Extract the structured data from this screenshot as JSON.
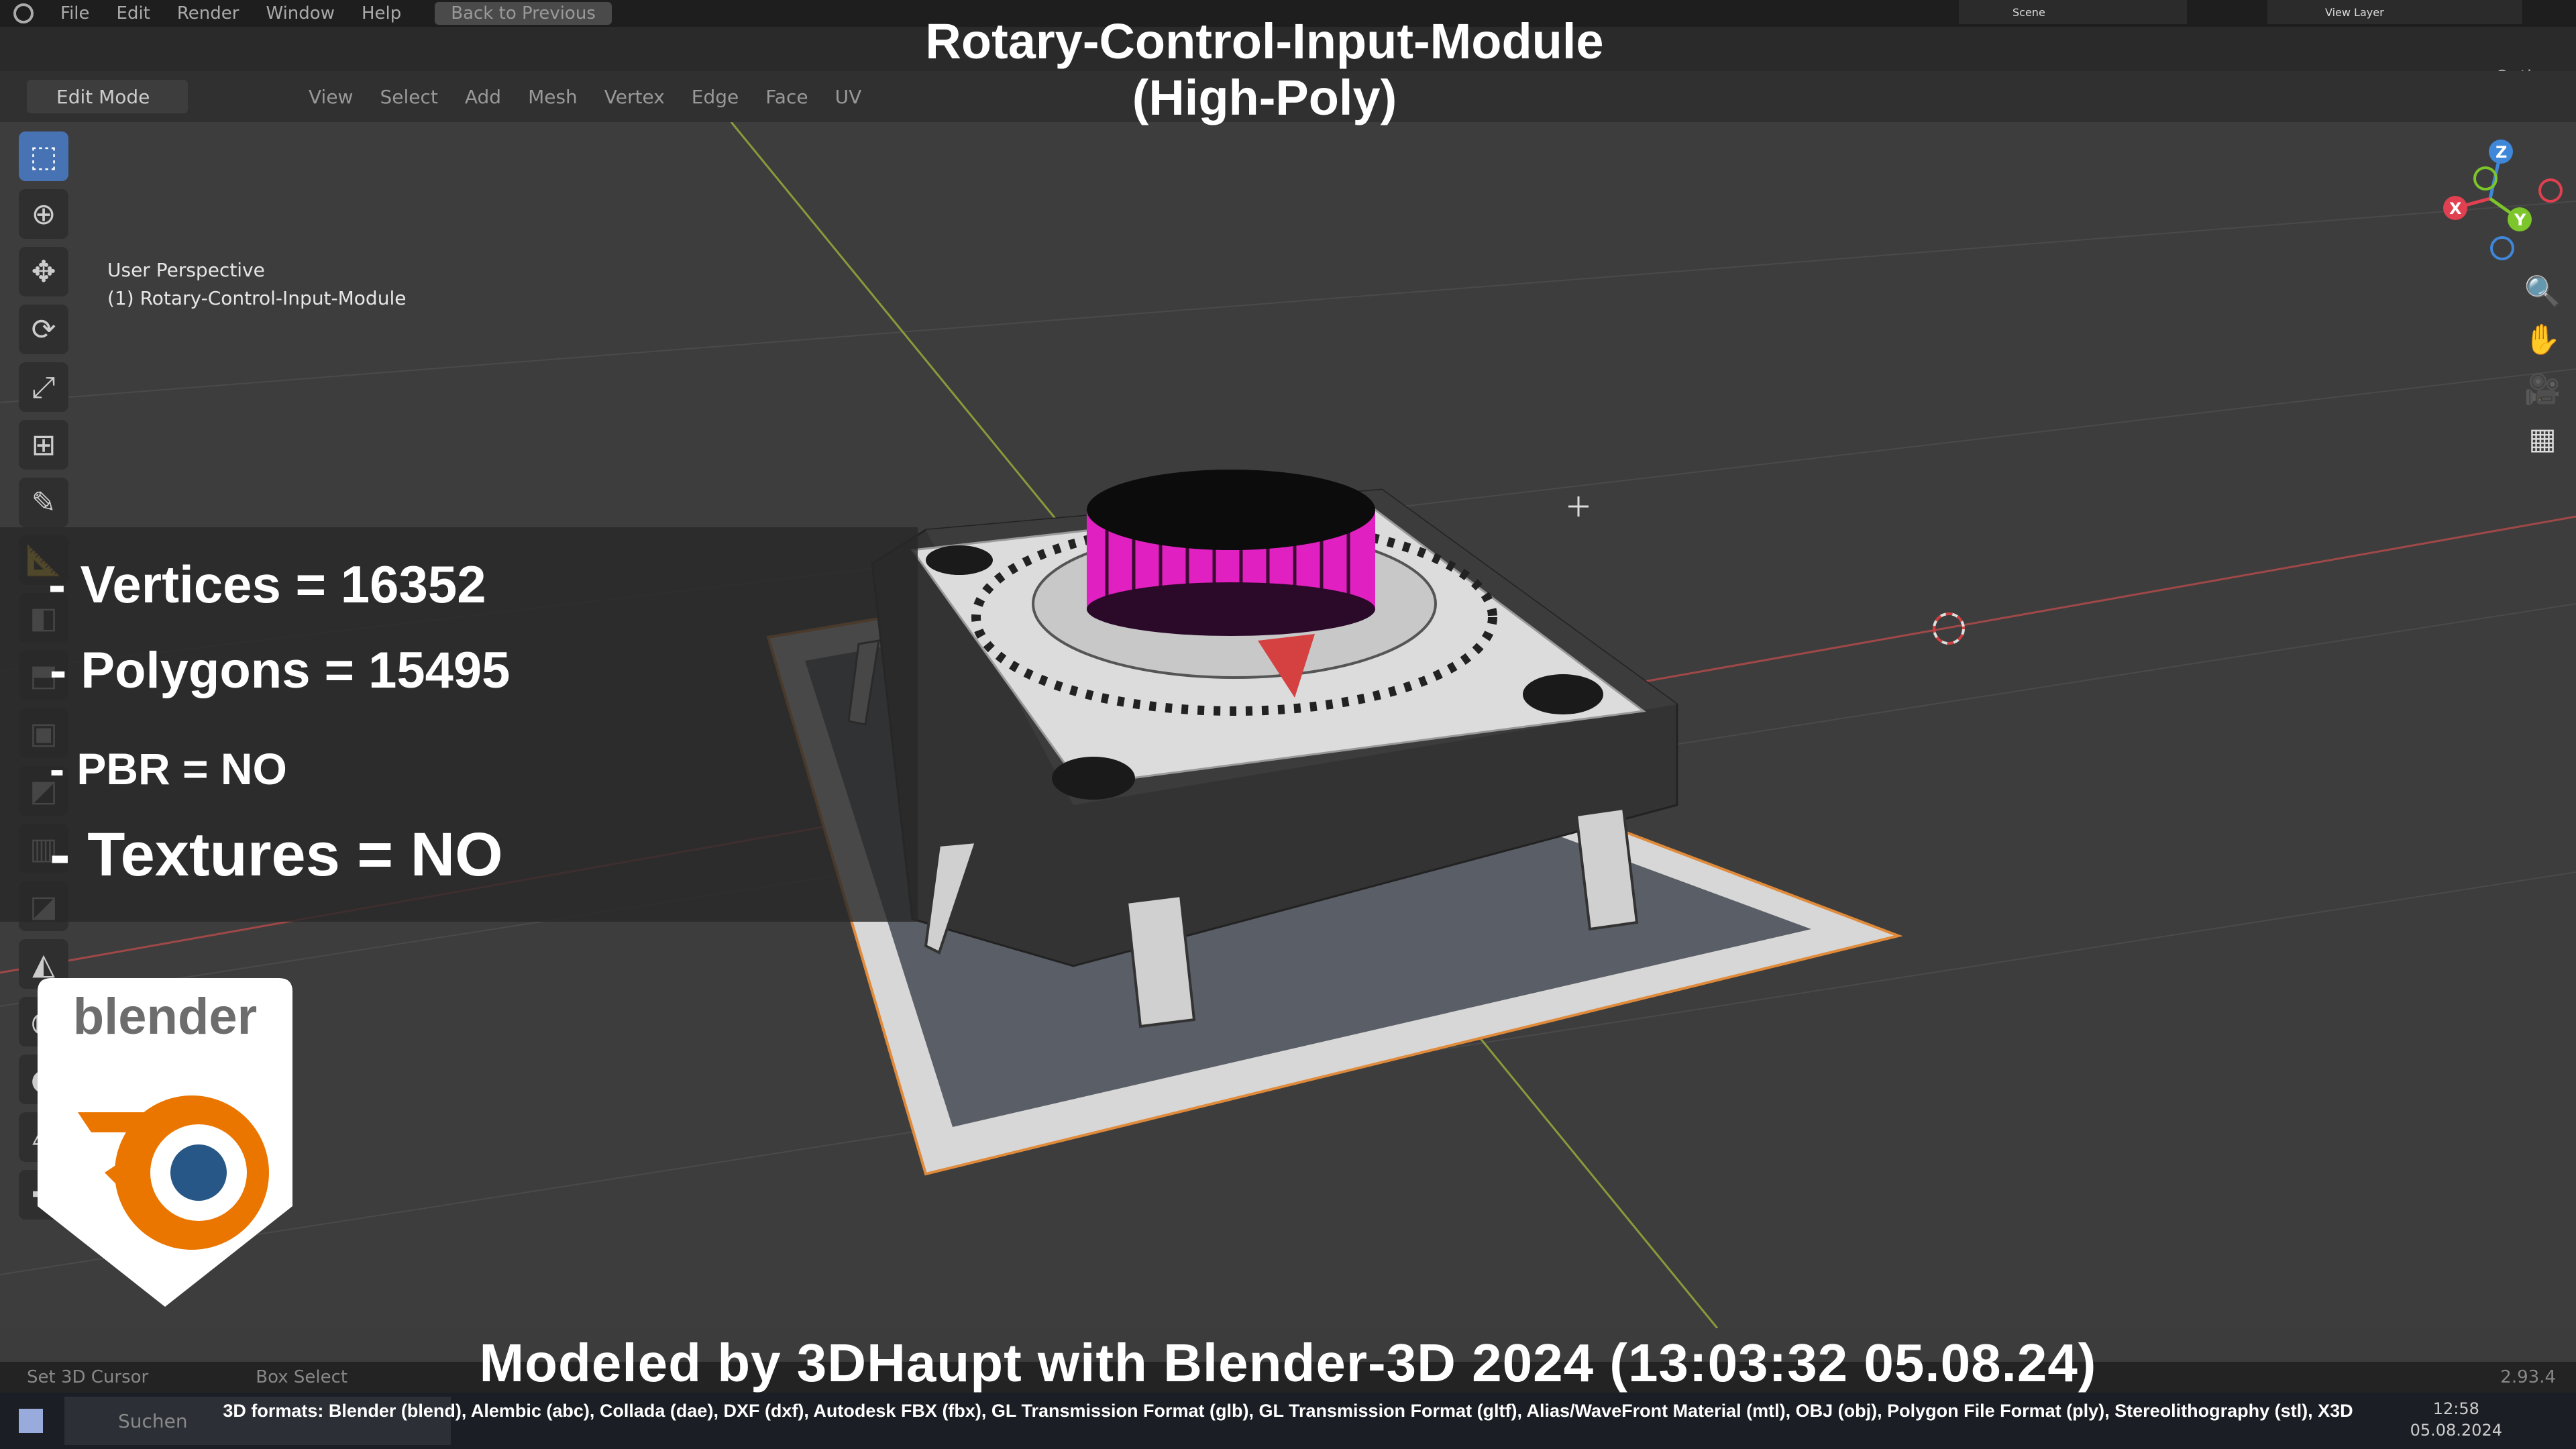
{
  "menubar": {
    "items": [
      "File",
      "Edit",
      "Render",
      "Window",
      "Help"
    ],
    "back_to_previous": "Back to Previous",
    "scene": "Scene",
    "view_layer": "View Layer"
  },
  "header": {
    "mode": "Edit Mode",
    "menus": [
      "View",
      "Select",
      "Add",
      "Mesh",
      "Vertex",
      "Edge",
      "Face",
      "UV"
    ],
    "options": "Options",
    "axes": [
      "X",
      "Y",
      "Z"
    ]
  },
  "viewport": {
    "perspective": "User Perspective",
    "object_name": "(1) Rotary-Control-Input-Module"
  },
  "overlay": {
    "title_line1": "Rotary-Control-Input-Module",
    "title_line2": "(High-Poly)",
    "vertices": "- Vertices = 16352",
    "polygons": "- Polygons = 15495",
    "pbr": "- PBR =  NO",
    "textures": "- Textures = NO",
    "logo_word": "blender",
    "credit": "Modeled by 3DHaupt with Blender-3D 2024 (13:03:32  05.08.24)",
    "formats": "3D formats: Blender (blend), Alembic (abc), Collada (dae), DXF (dxf), Autodesk FBX (fbx), GL Transmission Format (glb), GL Transmission Format (gltf), Alias/WaveFront Material (mtl), OBJ (obj), Polygon File Format (ply), Stereolithography (stl), X3D"
  },
  "statusbar": {
    "set_3d_cursor": "Set 3D Cursor",
    "box_select": "Box Select",
    "version": "2.93.4"
  },
  "taskbar": {
    "search": "Suchen",
    "time": "12:58",
    "date": "05.08.2024"
  },
  "gizmo": {
    "x_color": "#e0404f",
    "y_color": "#7cc52a",
    "z_color": "#3f87d8"
  }
}
